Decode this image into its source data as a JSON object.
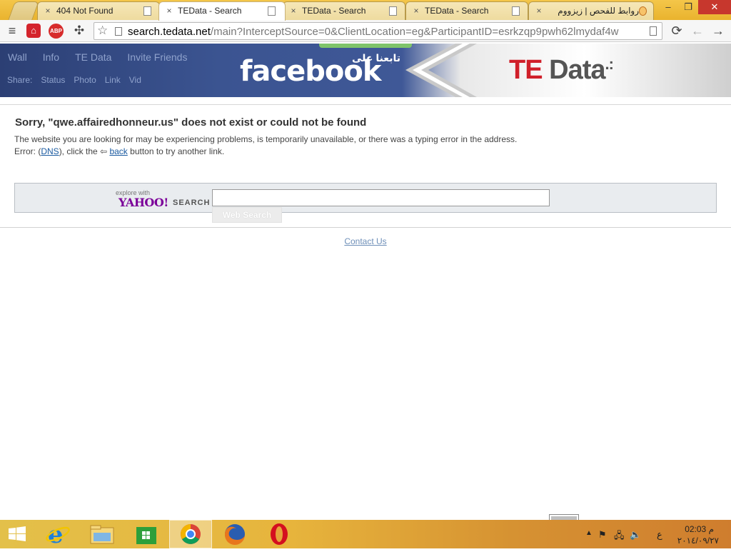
{
  "tabs": [
    {
      "title": "404 Not Found"
    },
    {
      "title": "TEData - Search",
      "active": true
    },
    {
      "title": "TEData - Search"
    },
    {
      "title": "TEData - Search"
    },
    {
      "title": "روابط للفحص | زيزووم"
    }
  ],
  "icons": {
    "tab_close": "×",
    "menu": "≡",
    "star": "☆",
    "reload": "⟳",
    "back": "←",
    "forward": "→",
    "minimize": "–",
    "restore": "❐",
    "close": "✕",
    "avira": "⌂",
    "abp": "ABP",
    "extension": "✣"
  },
  "address": {
    "domain": "search.tedata.net",
    "path": "/main?InterceptSource=0&ClientLocation=eg&ParticipantID=esrkzqp9pwh62lmydaf4w"
  },
  "banner": {
    "fb_tabs": [
      "Wall",
      "Info",
      "TE Data",
      "Invite Friends"
    ],
    "fb_share_label": "Share:",
    "fb_share_items": [
      "Status",
      "Photo",
      "Link",
      "Vid"
    ],
    "facebook_text": "facebook",
    "arabic_text": "تابعنا على",
    "te_prefix": "TE",
    "te_suffix": " Data",
    "te_dots": ".:"
  },
  "error": {
    "title": "Sorry, \"qwe.affairedhonneur.us\" does not exist or could not be found",
    "description": "The website you are looking for may be experiencing problems, is temporarily unavailable, or there was a typing error in the address.",
    "line_prefix": "Error: (",
    "dns_link": "DNS",
    "line_mid": "), click the ",
    "back_arrow": "⇦",
    "back_link": "back",
    "line_suffix": " button to try another link."
  },
  "search": {
    "explore_label": "explore with",
    "yahoo_label": "YAHOO!",
    "search_label": "SEARCH",
    "input_value": "",
    "button_label": "Web Search"
  },
  "footer": {
    "contact_label": "Contact Us"
  },
  "taskbar": {
    "tray_ime": "ع",
    "clock_time": "02:03 م",
    "clock_date": "٢٠١٤/٠٩/٢٧"
  }
}
